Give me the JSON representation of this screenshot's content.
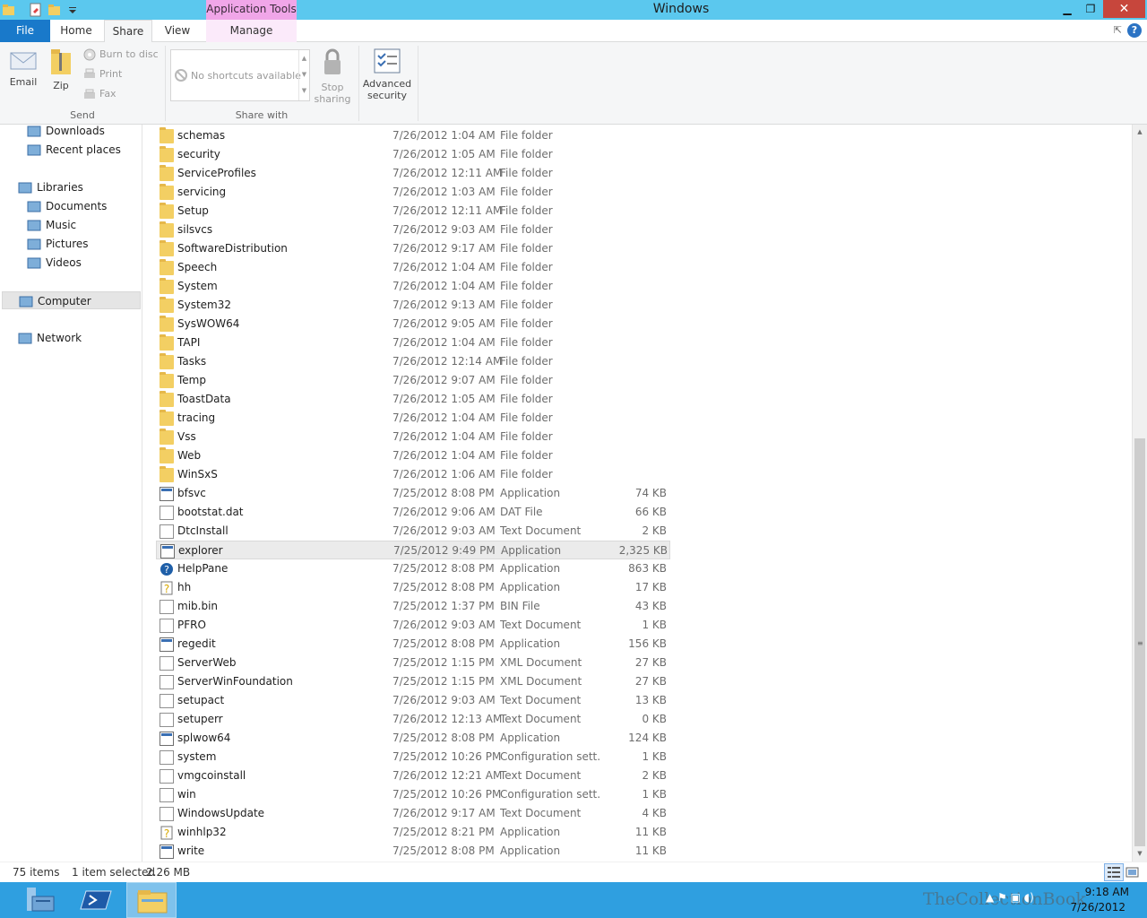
{
  "window": {
    "title": "Windows",
    "context_tab": "Application Tools",
    "close_glyph": "✕",
    "minimize_glyph": "▁",
    "maximize_glyph": "❐"
  },
  "ribbon_tabs": {
    "file": "File",
    "home": "Home",
    "share": "Share",
    "view": "View",
    "manage": "Manage",
    "active": "Share"
  },
  "ribbon": {
    "send_group": {
      "label": "Send",
      "email": "Email",
      "zip": "Zip",
      "burn": "Burn to disc",
      "print": "Print",
      "fax": "Fax"
    },
    "share_group": {
      "label": "Share with",
      "shortcuts_placeholder": "No shortcuts available",
      "stop_sharing_line1": "Stop",
      "stop_sharing_line2": "sharing"
    },
    "advanced_security_line1": "Advanced",
    "advanced_security_line2": "security",
    "help_glyph": "?"
  },
  "nav_pane": {
    "items": [
      {
        "label": "Downloads",
        "icon": "downloads-folder-icon"
      },
      {
        "label": "Recent places",
        "icon": "recent-places-icon"
      },
      {
        "label": "Libraries",
        "icon": "libraries-icon"
      },
      {
        "label": "Documents",
        "icon": "documents-library-icon"
      },
      {
        "label": "Music",
        "icon": "music-library-icon"
      },
      {
        "label": "Pictures",
        "icon": "pictures-library-icon"
      },
      {
        "label": "Videos",
        "icon": "videos-library-icon"
      },
      {
        "label": "Computer",
        "icon": "computer-icon"
      },
      {
        "label": "Network",
        "icon": "network-icon"
      }
    ]
  },
  "files": [
    {
      "name": "schemas",
      "date": "7/26/2012 1:04 AM",
      "type": "File folder",
      "size": "",
      "kind": "folder"
    },
    {
      "name": "security",
      "date": "7/26/2012 1:05 AM",
      "type": "File folder",
      "size": "",
      "kind": "folder"
    },
    {
      "name": "ServiceProfiles",
      "date": "7/26/2012 12:11 AM",
      "type": "File folder",
      "size": "",
      "kind": "folder"
    },
    {
      "name": "servicing",
      "date": "7/26/2012 1:03 AM",
      "type": "File folder",
      "size": "",
      "kind": "folder"
    },
    {
      "name": "Setup",
      "date": "7/26/2012 12:11 AM",
      "type": "File folder",
      "size": "",
      "kind": "folder"
    },
    {
      "name": "silsvcs",
      "date": "7/26/2012 9:03 AM",
      "type": "File folder",
      "size": "",
      "kind": "folder"
    },
    {
      "name": "SoftwareDistribution",
      "date": "7/26/2012 9:17 AM",
      "type": "File folder",
      "size": "",
      "kind": "folder"
    },
    {
      "name": "Speech",
      "date": "7/26/2012 1:04 AM",
      "type": "File folder",
      "size": "",
      "kind": "folder"
    },
    {
      "name": "System",
      "date": "7/26/2012 1:04 AM",
      "type": "File folder",
      "size": "",
      "kind": "folder"
    },
    {
      "name": "System32",
      "date": "7/26/2012 9:13 AM",
      "type": "File folder",
      "size": "",
      "kind": "folder"
    },
    {
      "name": "SysWOW64",
      "date": "7/26/2012 9:05 AM",
      "type": "File folder",
      "size": "",
      "kind": "folder"
    },
    {
      "name": "TAPI",
      "date": "7/26/2012 1:04 AM",
      "type": "File folder",
      "size": "",
      "kind": "folder"
    },
    {
      "name": "Tasks",
      "date": "7/26/2012 12:14 AM",
      "type": "File folder",
      "size": "",
      "kind": "folder"
    },
    {
      "name": "Temp",
      "date": "7/26/2012 9:07 AM",
      "type": "File folder",
      "size": "",
      "kind": "folder"
    },
    {
      "name": "ToastData",
      "date": "7/26/2012 1:05 AM",
      "type": "File folder",
      "size": "",
      "kind": "folder"
    },
    {
      "name": "tracing",
      "date": "7/26/2012 1:04 AM",
      "type": "File folder",
      "size": "",
      "kind": "folder"
    },
    {
      "name": "Vss",
      "date": "7/26/2012 1:04 AM",
      "type": "File folder",
      "size": "",
      "kind": "folder"
    },
    {
      "name": "Web",
      "date": "7/26/2012 1:04 AM",
      "type": "File folder",
      "size": "",
      "kind": "folder"
    },
    {
      "name": "WinSxS",
      "date": "7/26/2012 1:06 AM",
      "type": "File folder",
      "size": "",
      "kind": "folder"
    },
    {
      "name": "bfsvc",
      "date": "7/25/2012 8:08 PM",
      "type": "Application",
      "size": "74 KB",
      "kind": "app"
    },
    {
      "name": "bootstat.dat",
      "date": "7/26/2012 9:06 AM",
      "type": "DAT File",
      "size": "66 KB",
      "kind": "doc"
    },
    {
      "name": "DtcInstall",
      "date": "7/26/2012 9:03 AM",
      "type": "Text Document",
      "size": "2 KB",
      "kind": "doc"
    },
    {
      "name": "explorer",
      "date": "7/25/2012 9:49 PM",
      "type": "Application",
      "size": "2,325 KB",
      "kind": "app",
      "selected": true
    },
    {
      "name": "HelpPane",
      "date": "7/25/2012 8:08 PM",
      "type": "Application",
      "size": "863 KB",
      "kind": "help"
    },
    {
      "name": "hh",
      "date": "7/25/2012 8:08 PM",
      "type": "Application",
      "size": "17 KB",
      "kind": "help2"
    },
    {
      "name": "mib.bin",
      "date": "7/25/2012 1:37 PM",
      "type": "BIN File",
      "size": "43 KB",
      "kind": "doc"
    },
    {
      "name": "PFRO",
      "date": "7/26/2012 9:03 AM",
      "type": "Text Document",
      "size": "1 KB",
      "kind": "doc"
    },
    {
      "name": "regedit",
      "date": "7/25/2012 8:08 PM",
      "type": "Application",
      "size": "156 KB",
      "kind": "app"
    },
    {
      "name": "ServerWeb",
      "date": "7/25/2012 1:15 PM",
      "type": "XML Document",
      "size": "27 KB",
      "kind": "doc"
    },
    {
      "name": "ServerWinFoundation",
      "date": "7/25/2012 1:15 PM",
      "type": "XML Document",
      "size": "27 KB",
      "kind": "doc"
    },
    {
      "name": "setupact",
      "date": "7/26/2012 9:03 AM",
      "type": "Text Document",
      "size": "13 KB",
      "kind": "doc"
    },
    {
      "name": "setuperr",
      "date": "7/26/2012 12:13 AM",
      "type": "Text Document",
      "size": "0 KB",
      "kind": "doc"
    },
    {
      "name": "splwow64",
      "date": "7/25/2012 8:08 PM",
      "type": "Application",
      "size": "124 KB",
      "kind": "app"
    },
    {
      "name": "system",
      "date": "7/25/2012 10:26 PM",
      "type": "Configuration sett...",
      "size": "1 KB",
      "kind": "doc"
    },
    {
      "name": "vmgcoinstall",
      "date": "7/26/2012 12:21 AM",
      "type": "Text Document",
      "size": "2 KB",
      "kind": "doc"
    },
    {
      "name": "win",
      "date": "7/25/2012 10:26 PM",
      "type": "Configuration sett...",
      "size": "1 KB",
      "kind": "doc"
    },
    {
      "name": "WindowsUpdate",
      "date": "7/26/2012 9:17 AM",
      "type": "Text Document",
      "size": "4 KB",
      "kind": "doc"
    },
    {
      "name": "winhlp32",
      "date": "7/25/2012 8:21 PM",
      "type": "Application",
      "size": "11 KB",
      "kind": "help2"
    },
    {
      "name": "write",
      "date": "7/25/2012 8:08 PM",
      "type": "Application",
      "size": "11 KB",
      "kind": "app"
    }
  ],
  "status": {
    "item_count": "75 items",
    "selected": "1 item selected",
    "selected_size": "2.26 MB"
  },
  "taskbar": {
    "watermark": "TheCollectionBook",
    "time": "9:18 AM",
    "date": "7/26/2012"
  },
  "colors": {
    "titlebar": "#5bc8ee",
    "file_tab": "#1979ca",
    "context_tab": "#f0a6e8",
    "taskbar": "#2f9fe0",
    "close_button": "#c7463c"
  }
}
